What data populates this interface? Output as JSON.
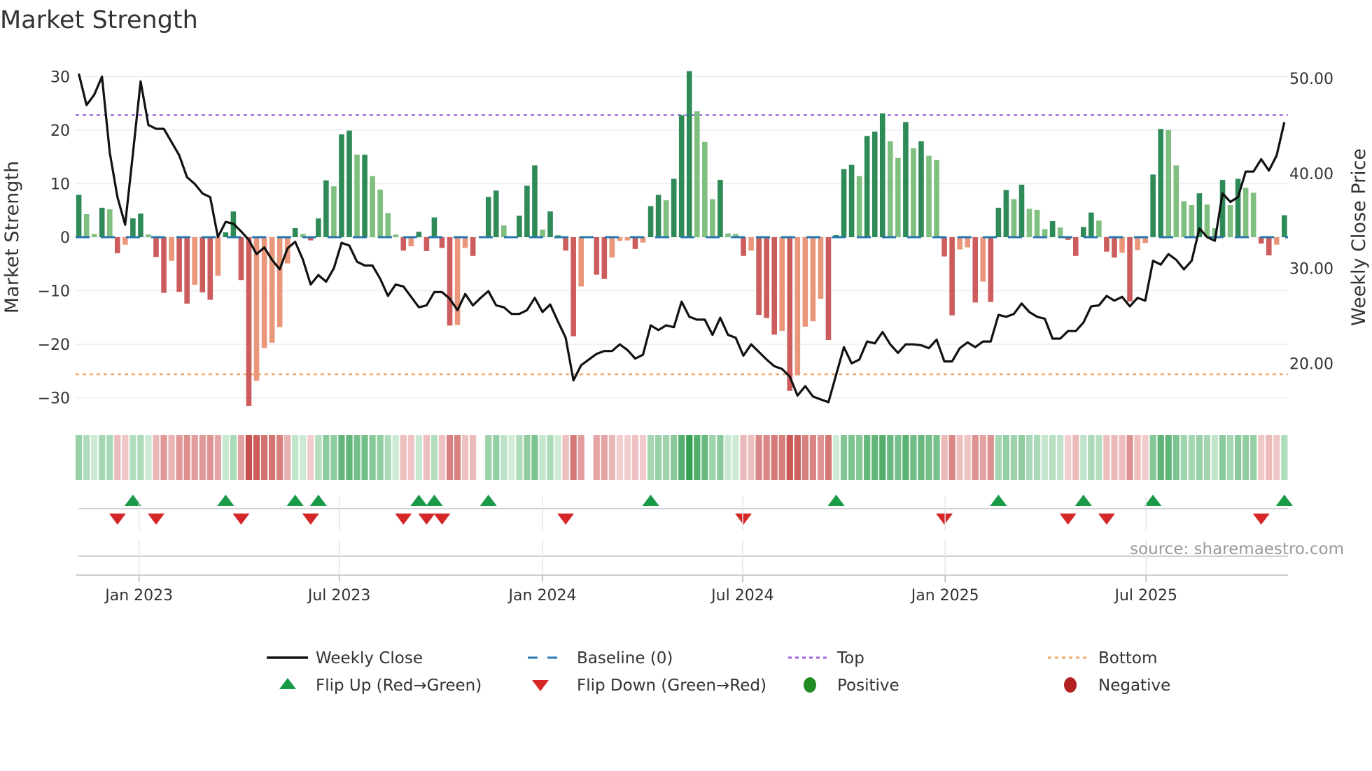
{
  "title": "Market Strength",
  "source": "source: sharemaestro.com",
  "legend": {
    "weekly_close": "Weekly Close",
    "baseline": "Baseline (0)",
    "top": "Top",
    "bottom": "Bottom",
    "flip_up": "Flip Up (Red→Green)",
    "flip_down": "Flip Down (Green→Red)",
    "positive": "Positive",
    "negative": "Negative"
  },
  "colors": {
    "rising_positive": "#2e8b57",
    "falling_positive": "#7fbf7f",
    "falling_negative": "#cd5c5c",
    "rising_negative": "#e9967a",
    "price_line": "#111111",
    "baseline": "#2a77ad",
    "top": "#a366e0",
    "bottom": "#f0a868",
    "flip_up": "#1a9a48",
    "flip_down": "#d62728",
    "positive": "#228b22",
    "negative": "#b22222"
  },
  "chart_data": {
    "type": "bar",
    "title": "Market Strength",
    "ylabel": "Market Strength",
    "y2label": "Weekly Close Price",
    "xlabel": "",
    "frequency": "weekly",
    "ylim": [
      -33.7,
      33.7
    ],
    "y2lim": [
      14.2,
      52.3
    ],
    "yticks": [
      30,
      20,
      10,
      0,
      -10,
      -20,
      -30
    ],
    "ytick_labels": [
      "30",
      "20",
      "10",
      "0",
      "−10",
      "−20",
      "−30"
    ],
    "y2ticks": [
      50,
      40,
      30,
      20
    ],
    "y2tick_labels": [
      "50.00",
      "40.00",
      "30.00",
      "20.00"
    ],
    "x_ticks": [
      {
        "label": "Jan 2023",
        "week": 7.8
      },
      {
        "label": "Jul 2023",
        "week": 33.7
      },
      {
        "label": "Jan 2024",
        "week": 60.0
      },
      {
        "label": "Jul 2024",
        "week": 85.9
      },
      {
        "label": "Jan 2025",
        "week": 112.1
      },
      {
        "label": "Jul 2025",
        "week": 138.1
      }
    ],
    "grid": true,
    "legend_position": "bottom",
    "top_level": 22.8,
    "bottom_level": -25.6,
    "baseline": 0,
    "series": [
      {
        "name": "Market Strength",
        "type": "bar",
        "values": [
          7.9,
          4.3,
          0.6,
          5.5,
          5.2,
          -3.0,
          -1.4,
          3.5,
          4.4,
          0.5,
          -3.7,
          -10.4,
          -4.4,
          -10.2,
          -12.4,
          -8.9,
          -10.3,
          -11.7,
          -7.2,
          0.9,
          4.8,
          -8.0,
          -31.5,
          -26.8,
          -20.7,
          -19.7,
          -16.8,
          -4.9,
          1.7,
          0.6,
          -0.6,
          3.5,
          10.6,
          9.5,
          19.2,
          19.9,
          15.4,
          15.4,
          11.4,
          8.9,
          4.5,
          0.5,
          -2.5,
          -1.7,
          1.0,
          -2.6,
          3.7,
          -2.0,
          -16.5,
          -16.4,
          -2.0,
          -3.5,
          0,
          7.5,
          8.7,
          2.2,
          0.2,
          4.0,
          9.6,
          13.4,
          1.4,
          4.8,
          0.4,
          -2.5,
          -18.5,
          -9.2,
          0,
          -7.0,
          -7.8,
          -3.8,
          -0.7,
          -0.6,
          -2.2,
          -1.0,
          5.8,
          7.9,
          6.9,
          10.9,
          22.8,
          31.0,
          23.5,
          17.8,
          7.1,
          10.7,
          0.7,
          0.6,
          -3.5,
          -2.5,
          -14.5,
          -15.1,
          -18.2,
          -17.5,
          -28.7,
          -25.8,
          -16.7,
          -15.7,
          -11.5,
          -19.2,
          0.4,
          12.7,
          13.5,
          11.4,
          18.9,
          19.7,
          23.1,
          17.9,
          14.8,
          21.5,
          16.6,
          17.9,
          15.2,
          14.4,
          -3.6,
          -14.6,
          -2.3,
          -1.9,
          -12.2,
          -8.3,
          -12.1,
          5.5,
          8.8,
          7.1,
          9.8,
          5.3,
          5.1,
          1.5,
          3.0,
          1.8,
          -0.5,
          -3.5,
          1.9,
          4.6,
          3.1,
          -2.7,
          -3.8,
          -2.9,
          -12.0,
          -2.4,
          -1.1,
          11.7,
          20.2,
          20.0,
          13.4,
          6.7,
          6.0,
          8.2,
          6.1,
          1.7,
          10.7,
          6.0,
          10.9,
          9.2,
          8.3,
          -1.2,
          -3.4,
          -1.4,
          4.1
        ]
      },
      {
        "name": "Weekly Close",
        "type": "line",
        "axis": "right",
        "values": [
          50.5,
          47.2,
          48.3,
          50.2,
          42.2,
          37.5,
          34.6,
          42.1,
          49.7,
          45.1,
          44.7,
          44.7,
          43.3,
          41.9,
          39.6,
          38.9,
          37.9,
          37.5,
          33.3,
          34.9,
          34.7,
          33.9,
          33.0,
          31.5,
          32.2,
          30.9,
          29.9,
          32.1,
          32.8,
          30.9,
          28.3,
          29.3,
          28.6,
          30.0,
          32.7,
          32.4,
          30.7,
          30.3,
          30.3,
          28.9,
          27.1,
          28.3,
          28.1,
          27.0,
          25.9,
          26.1,
          27.5,
          27.5,
          26.8,
          25.6,
          27.3,
          26.1,
          26.9,
          27.6,
          26.1,
          25.9,
          25.2,
          25.2,
          25.6,
          26.9,
          25.4,
          26.2,
          24.4,
          22.7,
          18.2,
          19.8,
          20.4,
          21.0,
          21.3,
          21.3,
          22.0,
          21.4,
          20.5,
          20.9,
          24.0,
          23.5,
          24.0,
          23.8,
          26.5,
          24.9,
          24.6,
          24.6,
          23.0,
          24.8,
          23.0,
          22.7,
          20.8,
          22.0,
          21.2,
          20.4,
          19.7,
          19.4,
          18.6,
          16.6,
          17.6,
          16.5,
          16.2,
          15.9,
          18.8,
          21.7,
          20.0,
          20.4,
          22.3,
          22.1,
          23.3,
          22.0,
          21.1,
          22.0,
          22.0,
          21.9,
          21.6,
          22.5,
          20.2,
          20.2,
          21.6,
          22.2,
          21.7,
          22.3,
          22.3,
          25.1,
          24.9,
          25.2,
          26.3,
          25.4,
          24.9,
          24.7,
          22.6,
          22.6,
          23.4,
          23.4,
          24.3,
          26.0,
          26.1,
          27.1,
          26.6,
          27.0,
          26.0,
          26.9,
          26.6,
          30.8,
          30.4,
          31.5,
          30.9,
          29.9,
          30.8,
          34.2,
          33.3,
          32.9,
          37.9,
          37.0,
          37.5,
          40.2,
          40.2,
          41.5,
          40.3,
          41.9,
          45.4
        ]
      }
    ]
  }
}
